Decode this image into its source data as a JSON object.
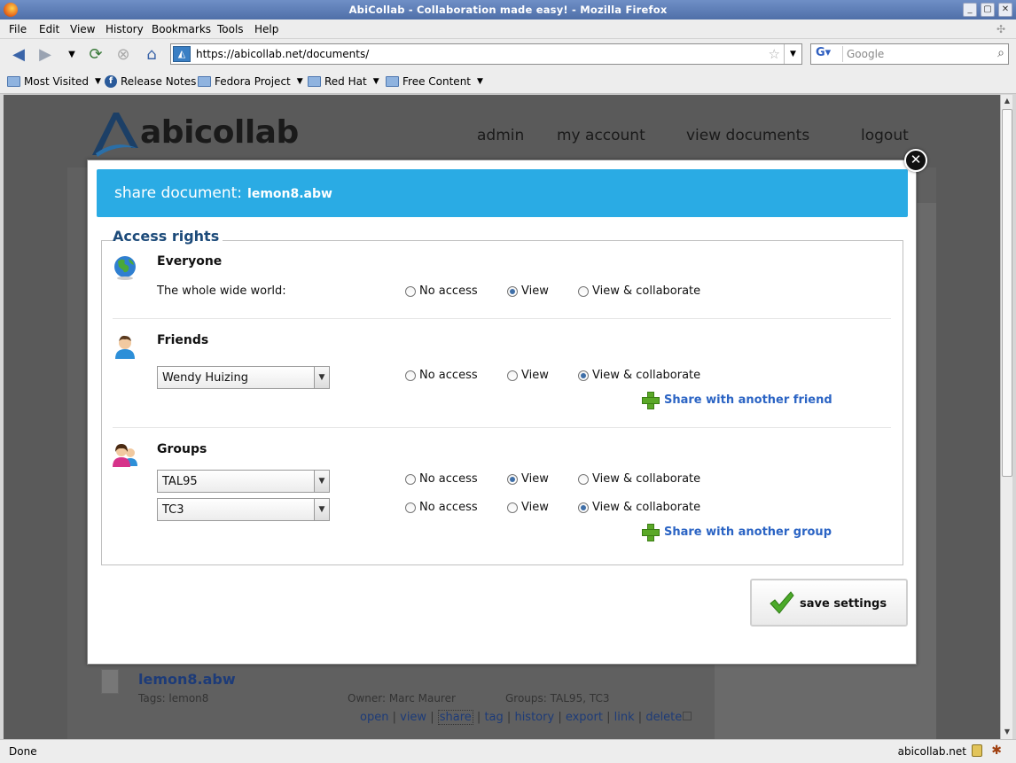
{
  "window": {
    "title": "AbiCollab - Collaboration made easy! - Mozilla Firefox"
  },
  "menu": [
    "File",
    "Edit",
    "View",
    "History",
    "Bookmarks",
    "Tools",
    "Help"
  ],
  "navigation": {
    "url": "https://abicollab.net/documents/",
    "search_placeholder": "Google"
  },
  "bookmarks": [
    "Most Visited",
    "Release Notes",
    "Fedora Project",
    "Red Hat",
    "Free Content"
  ],
  "site": {
    "logo": "abicollab",
    "nav": [
      "admin",
      "my account",
      "view documents",
      "logout"
    ]
  },
  "background_document": {
    "title": "lemon8.abw",
    "tags": "Tags: lemon8",
    "owner": "Owner: Marc Maurer",
    "groups": "Groups: TAL95, TC3",
    "actions": [
      "open",
      "view",
      "share",
      "tag",
      "history",
      "export",
      "link",
      "delete"
    ]
  },
  "dialog": {
    "title_prefix": "share document:",
    "filename": "lemon8.abw",
    "legend": "Access rights",
    "options": [
      "No access",
      "View",
      "View & collaborate"
    ],
    "everyone": {
      "title": "Everyone",
      "label": "The whole wide world:",
      "selected": "View"
    },
    "friends": {
      "title": "Friends",
      "rows": [
        {
          "name": "Wendy Huizing",
          "selected": "View & collaborate"
        }
      ],
      "add_label": "Share with another friend"
    },
    "groups": {
      "title": "Groups",
      "rows": [
        {
          "name": "TAL95",
          "selected": "View"
        },
        {
          "name": "TC3",
          "selected": "View & collaborate"
        }
      ],
      "add_label": "Share with another group"
    },
    "save_label": "save settings"
  },
  "status": {
    "left": "Done",
    "right": "abicollab.net"
  },
  "colors": {
    "header_blue": "#2aabe4",
    "link_blue": "#2b64c4",
    "legend_blue": "#1d4b7a",
    "plus_green": "#5aa827"
  }
}
